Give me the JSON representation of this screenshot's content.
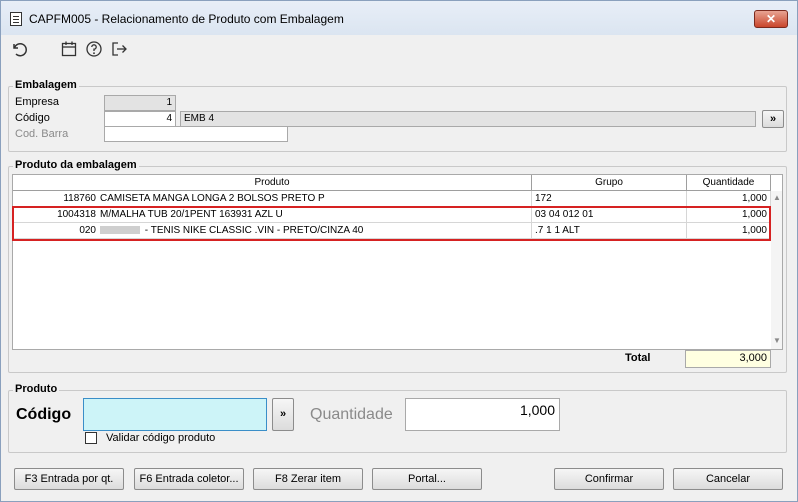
{
  "window": {
    "title": "CAPFM005 - Relacionamento de Produto com Embalagem",
    "close_label": "✕"
  },
  "toolbar": {
    "icons": [
      "undo-icon",
      "calendar-icon",
      "help-icon",
      "exit-icon"
    ]
  },
  "embalagem": {
    "title": "Embalagem",
    "empresa_label": "Empresa",
    "empresa_value": "1",
    "codigo_label": "Código",
    "codigo_value": "4",
    "codigo_desc": "EMB 4",
    "codbarra_label": "Cod. Barra",
    "codbarra_value": "",
    "lookup_label": "»"
  },
  "produto_embalagem": {
    "title": "Produto da embalagem",
    "columns": [
      "Produto",
      "Grupo",
      "Quantidade"
    ],
    "rows": [
      {
        "code": "118760",
        "desc": "CAMISETA MANGA LONGA 2 BOLSOS PRETO P",
        "grupo": "172",
        "qtd": "1,000"
      },
      {
        "code": "1004318",
        "desc": "M/MALHA TUB 20/1PENT 163931 AZL U",
        "grupo": "03 04 012 01",
        "qtd": "1,000"
      },
      {
        "code": "020",
        "desc": " - TENIS NIKE CLASSIC .VIN - PRETO/CINZA 40",
        "grupo": ".7 1 1 ALT",
        "qtd": "1,000"
      }
    ],
    "total_label": "Total",
    "total_value": "3,000"
  },
  "produto": {
    "title": "Produto",
    "codigo_label": "Código",
    "codigo_value": "",
    "lookup_label": "»",
    "quantidade_label": "Quantidade",
    "quantidade_value": "1,000",
    "validar_label": "Validar código produto",
    "validar_checked": false
  },
  "buttons": {
    "f3": "F3 Entrada por qt.",
    "f6": "F6 Entrada coletor...",
    "f8": "F8 Zerar item",
    "portal": "Portal...",
    "confirmar": "Confirmar",
    "cancelar": "Cancelar"
  },
  "colors": {
    "highlight": "#d62222",
    "codigo_input_bg": "#cdf4f8",
    "total_bg": "#ffffe1"
  }
}
